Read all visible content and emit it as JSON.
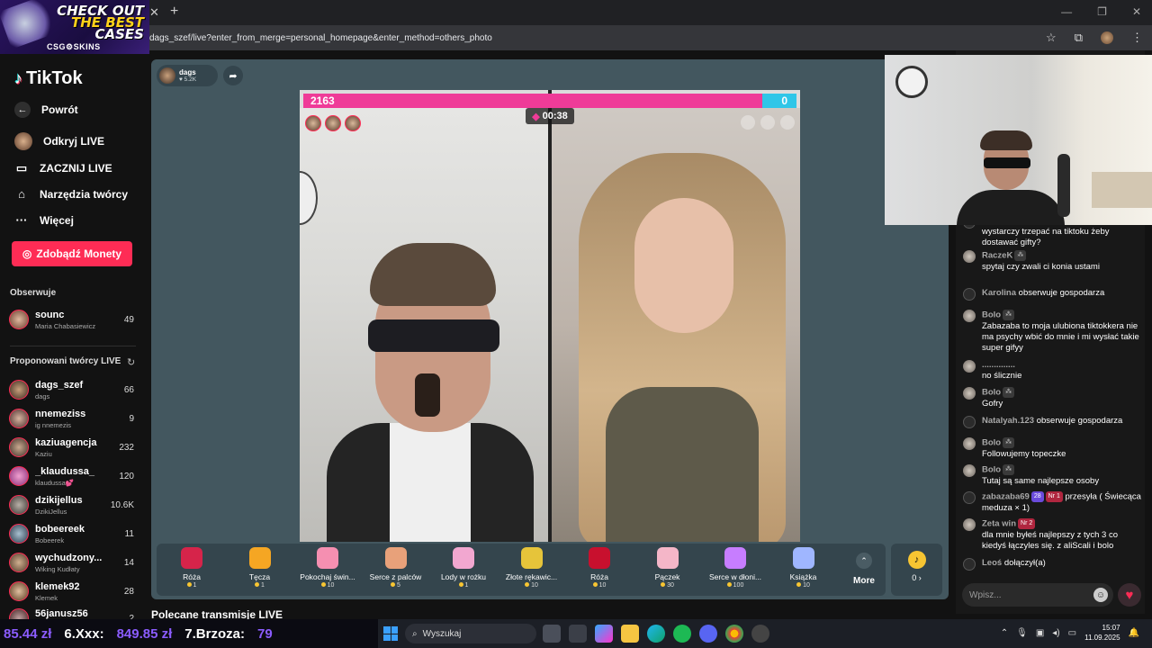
{
  "browser": {
    "ad_banner": {
      "line1": "CHECK OUT",
      "line2": "THE BEST",
      "line3": "CASES",
      "brand": "CSG⚙SKINS"
    },
    "url": "dags_szef/live?enter_from_merge=personal_homepage&enter_method=others_photo"
  },
  "sidebar": {
    "logo": "TikTok",
    "back": "Powrót",
    "nav": [
      {
        "label": "Odkryj LIVE",
        "icon": "explore-live-avatar"
      },
      {
        "label": "ZACZNIJ LIVE",
        "icon": "camera-icon"
      },
      {
        "label": "Narzędzia twórcy",
        "icon": "home-icon"
      },
      {
        "label": "Więcej",
        "icon": "more-dots-icon"
      }
    ],
    "coins_button": "Zdobądź Monety",
    "following_title": "Obserwuje",
    "following": [
      {
        "name": "sounc",
        "sub": "Maria Chabasiewicz",
        "count": "49"
      }
    ],
    "suggested_title": "Proponowani twórcy LIVE",
    "suggested": [
      {
        "name": "dags_szef",
        "sub": "dags",
        "count": "66"
      },
      {
        "name": "nnemeziss",
        "sub": "ig nnemezis",
        "count": "9"
      },
      {
        "name": "kaziuagencja",
        "sub": "Kaziu",
        "count": "232"
      },
      {
        "name": "_klaudussa_",
        "sub": "klaudussa💕",
        "count": "120"
      },
      {
        "name": "dzikijellus",
        "sub": "DzikiJellus",
        "count": "10.6K"
      },
      {
        "name": "bobeereek",
        "sub": "Bobeerek",
        "count": "11"
      },
      {
        "name": "wychudzony...",
        "sub": "Wiking Kudłaty",
        "count": "14"
      },
      {
        "name": "klemek92",
        "sub": "Klemek",
        "count": "28"
      },
      {
        "name": "56janusz56",
        "sub": "",
        "count": "2"
      }
    ]
  },
  "stream": {
    "host_name": "dags",
    "host_likes": "♥ 5.2K",
    "battle_left_score": "2163",
    "battle_right_score": "0",
    "battle_left_share": 0.93,
    "timer": "00:38",
    "gifts": [
      {
        "name": "Róża",
        "price": "1",
        "color": "#d6244a"
      },
      {
        "name": "Tęcza",
        "price": "1",
        "color": "#f5a623"
      },
      {
        "name": "Pokochaj świn...",
        "price": "10",
        "color": "#f58fb1"
      },
      {
        "name": "Serce z palców",
        "price": "5",
        "color": "#e8a17a"
      },
      {
        "name": "Lody w rożku",
        "price": "1",
        "color": "#f2a7d0"
      },
      {
        "name": "Złote rękawic...",
        "price": "10",
        "color": "#e6c43a"
      },
      {
        "name": "Róża",
        "price": "10",
        "color": "#c8102e"
      },
      {
        "name": "Pączek",
        "price": "30",
        "color": "#f4b6c8"
      },
      {
        "name": "Serce w dłoni...",
        "price": "100",
        "color": "#c77dff"
      },
      {
        "name": "Książka",
        "price": "10",
        "color": "#9fb6ff"
      }
    ],
    "more_label": "More",
    "coin_balance": "0 ›"
  },
  "recommended_title": "Polecane transmisje LIVE",
  "chat": {
    "messages": [
      {
        "who": "",
        "text": "wystarczy trzepać na tiktoku żeby dostawać gifty?",
        "badges": [],
        "avatar": "user"
      },
      {
        "who": "RaczeK",
        "text": "spytaj czy zwali ci konia ustami",
        "badges": [
          "mod"
        ],
        "avatar": "photo"
      },
      {
        "who": "Karolina",
        "text": "obserwuje gospodarza",
        "badges": [],
        "avatar": "user",
        "inline": true
      },
      {
        "who": "Bolo",
        "text": "Zabazaba to moja ulubiona tiktokkera nie ma psychy wbić do mnie i mi wysłać takie super gifyy",
        "badges": [
          "mod"
        ],
        "avatar": "photo"
      },
      {
        "who": "..............",
        "text": "no ślicznie",
        "badges": [],
        "avatar": "photo"
      },
      {
        "who": "Bolo",
        "text": "Gofry",
        "badges": [
          "mod"
        ],
        "avatar": "photo"
      },
      {
        "who": "Natalyah.123",
        "text": "obserwuje gospodarza",
        "badges": [],
        "avatar": "user",
        "inline": true
      },
      {
        "who": "Bolo",
        "text": "Followujemy topeczke",
        "badges": [
          "mod"
        ],
        "avatar": "photo"
      },
      {
        "who": "Bolo",
        "text": "Tutaj są same najlepsze osoby",
        "badges": [
          "mod"
        ],
        "avatar": "photo"
      },
      {
        "who": "zabazaba69",
        "text": "przesyła ( Świecąca meduza × 1)",
        "badges": [
          "28",
          "Nr 1"
        ],
        "avatar": "gift",
        "inline": true
      },
      {
        "who": "Zeta win",
        "text": "dla mnie byłeś najlepszy z tych 3 co kiedyś łączyles się. z aliScali i bolo",
        "badges": [
          "Nr 2"
        ],
        "avatar": "photo"
      },
      {
        "who": "Leoś",
        "text": "dołączył(a)",
        "badges": [],
        "avatar": "user",
        "inline": true
      }
    ],
    "input_placeholder": "Wpisz..."
  },
  "taskbar": {
    "ticker": [
      {
        "text": "85.44 zł",
        "color": "#8b5cff"
      },
      {
        "text": "6.Xxx:",
        "color": "#ffffff"
      },
      {
        "text": "849.85 zł",
        "color": "#8b5cff"
      },
      {
        "text": "7.Brzoza:",
        "color": "#ffffff"
      },
      {
        "text": "79",
        "color": "#8b5cff"
      }
    ],
    "search_placeholder": "Wyszukaj",
    "time": "15:07",
    "date": "11.09.2025"
  }
}
